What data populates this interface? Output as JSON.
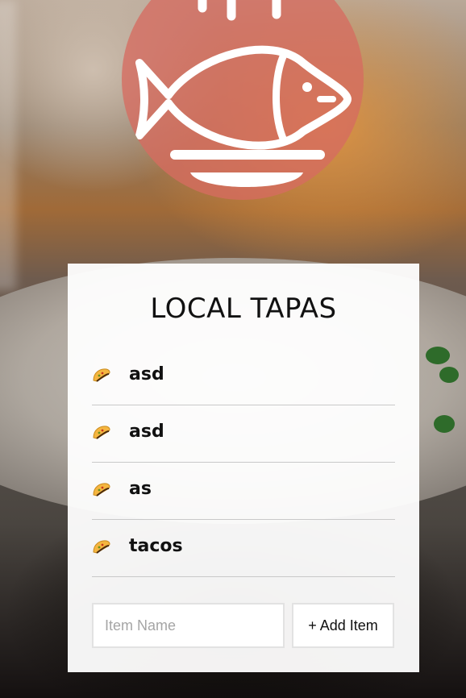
{
  "app": {
    "title": "LOCAL TAPAS",
    "logo_icon": "fish-on-plate-icon",
    "logo_color": "#d66c60"
  },
  "items": [
    {
      "icon": "taco-icon",
      "label": "asd"
    },
    {
      "icon": "taco-icon",
      "label": "asd"
    },
    {
      "icon": "taco-icon",
      "label": "as"
    },
    {
      "icon": "taco-icon",
      "label": "tacos"
    }
  ],
  "form": {
    "input_value": "",
    "input_placeholder": "Item Name",
    "add_button_label": "+ Add Item"
  }
}
